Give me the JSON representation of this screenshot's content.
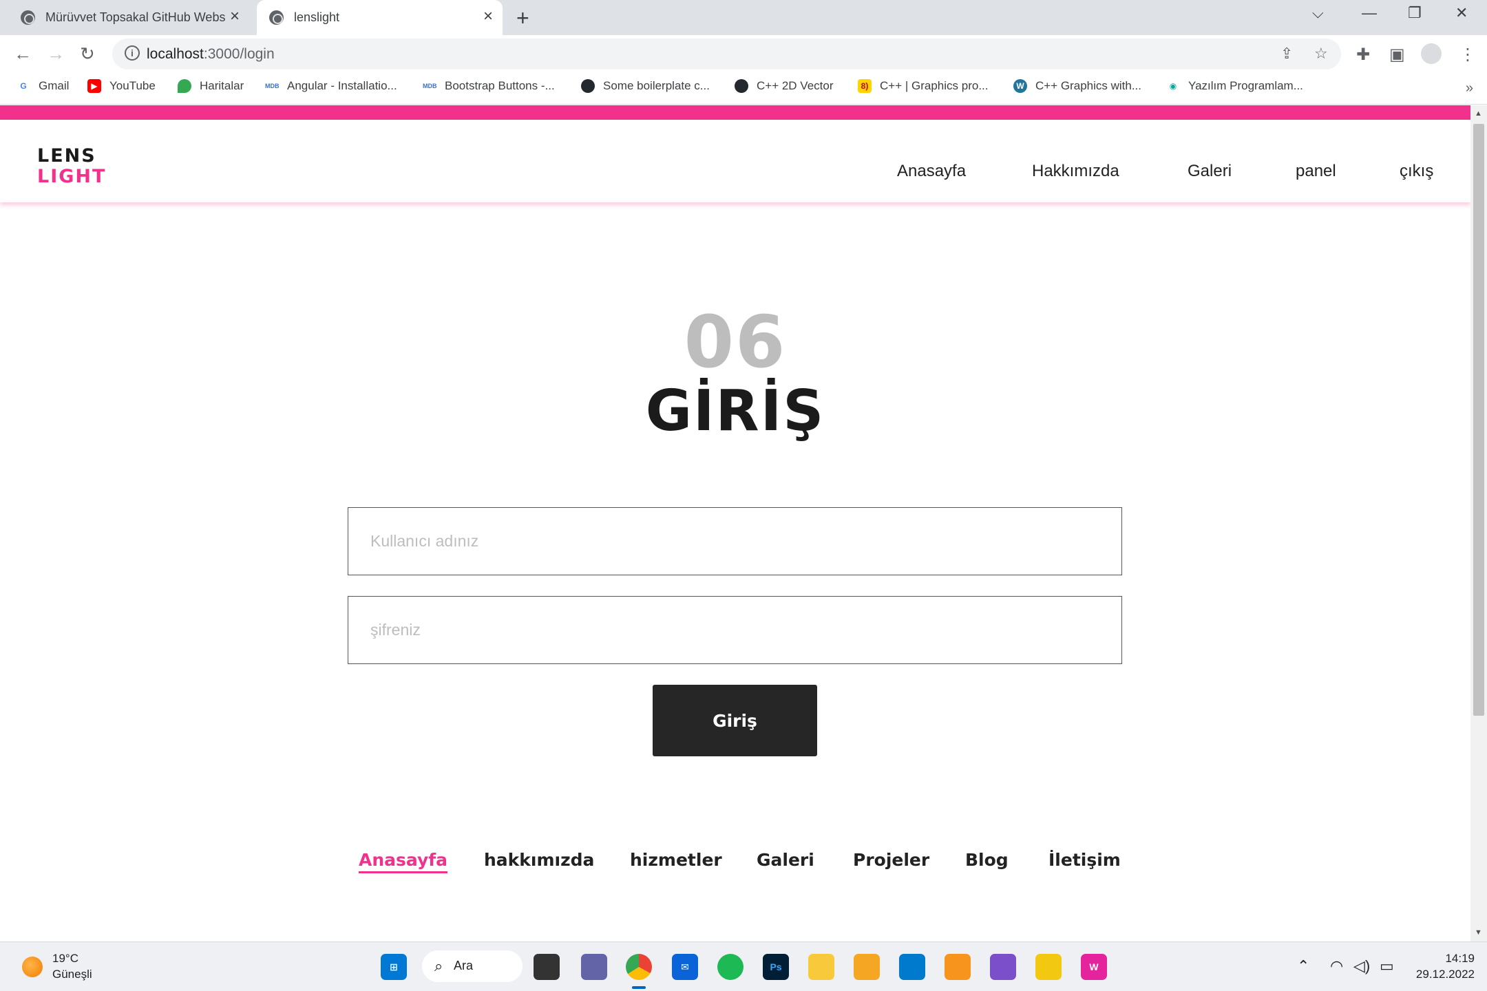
{
  "browser": {
    "tabs": [
      {
        "title": "Mürüvvet Topsakal GitHub Website",
        "active": false
      },
      {
        "title": "lenslight",
        "active": true
      }
    ],
    "url_host": "localhost",
    "url_path": ":3000/login",
    "bookmarks": [
      {
        "label": "Gmail",
        "icon": "gmail-icon"
      },
      {
        "label": "YouTube",
        "icon": "youtube-icon"
      },
      {
        "label": "Haritalar",
        "icon": "maps-icon"
      },
      {
        "label": "Angular - Installatio...",
        "icon": "mdb-icon"
      },
      {
        "label": "Bootstrap Buttons -...",
        "icon": "mdb-icon"
      },
      {
        "label": "Some boilerplate c...",
        "icon": "github-icon"
      },
      {
        "label": "C++ 2D Vector",
        "icon": "github-icon"
      },
      {
        "label": "C++ | Graphics pro...",
        "icon": "geeks-icon"
      },
      {
        "label": "C++ Graphics with...",
        "icon": "wordpress-icon"
      },
      {
        "label": "Yazılım Programlam...",
        "icon": "eye-icon"
      }
    ]
  },
  "site": {
    "logo_line1": "LENS",
    "logo_line2": "LIGHT",
    "nav": [
      "Anasayfa",
      "Hakkımızda",
      "Galeri",
      "panel",
      "çıkış"
    ],
    "accent": "#f1318b"
  },
  "login": {
    "number": "06",
    "title": "GİRİŞ",
    "username_placeholder": "Kullanıcı adınız",
    "password_placeholder": "şifreniz",
    "submit_label": "Giriş"
  },
  "footer_nav": {
    "items": [
      "Anasayfa",
      "hakkımızda",
      "hizmetler",
      "Galeri",
      "Projeler",
      "Blog",
      "İletişim"
    ],
    "active": "Anasayfa"
  },
  "taskbar": {
    "temperature": "19°C",
    "weather": "Güneşli",
    "search_label": "Ara",
    "time": "14:19",
    "date": "29.12.2022"
  }
}
